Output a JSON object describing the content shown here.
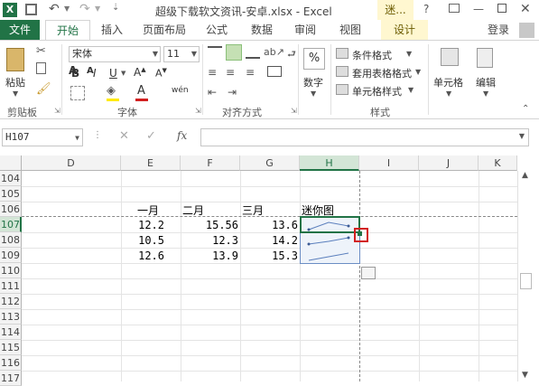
{
  "title": "超级下载软文资讯-安卓.xlsx - Excel",
  "title_right_tab": "迷...",
  "tabs": [
    "文件",
    "开始",
    "插入",
    "页面布局",
    "公式",
    "数据",
    "审阅",
    "视图",
    "设计"
  ],
  "login": "登录",
  "ribbon": {
    "paste": "粘贴",
    "font_name": "宋体",
    "font_size": "11",
    "percent": "%",
    "number": "数字",
    "cond_format": "条件格式",
    "table_format": "套用表格格式",
    "cell_style": "单元格样式",
    "cells": "单元格",
    "edit": "编辑",
    "groups": [
      "剪贴板",
      "字体",
      "对齐方式",
      "样式"
    ]
  },
  "namebox": "H107",
  "fx": "fx",
  "columns": [
    "D",
    "E",
    "F",
    "G",
    "H",
    "I",
    "J",
    "K"
  ],
  "rows": [
    "104",
    "105",
    "106",
    "107",
    "108",
    "109",
    "110",
    "111",
    "112",
    "113",
    "114",
    "115",
    "116",
    "117"
  ],
  "headers": [
    "一月",
    "二月",
    "三月",
    "迷你图"
  ],
  "data": [
    [
      "12.2",
      "15.56",
      "13.6"
    ],
    [
      "10.5",
      "12.3",
      "14.2"
    ],
    [
      "12.6",
      "13.9",
      "15.3"
    ]
  ],
  "colors": {
    "excel_green": "#217346",
    "selection": "#217346",
    "highlight": "#d21f1f"
  }
}
